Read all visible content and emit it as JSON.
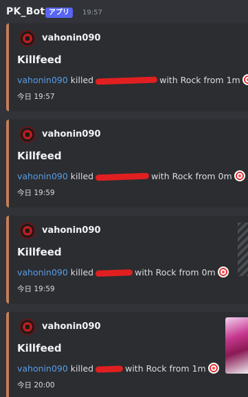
{
  "header": {
    "bot_name": "PK_Bot",
    "badge": "アプリ",
    "time": "19:57"
  },
  "embeds": [
    {
      "author": "vahonin090",
      "title": "Killfeed",
      "player": "vahonin090",
      "action": "killed",
      "weapon_text": "with Rock from 1m",
      "footer": "今日 19:57"
    },
    {
      "author": "vahonin090",
      "title": "Killfeed",
      "player": "vahonin090",
      "action": "killed",
      "weapon_text": "with Rock from 0m",
      "footer": "今日 19:59"
    },
    {
      "author": "vahonin090",
      "title": "Killfeed",
      "player": "vahonin090",
      "action": "killed",
      "weapon_text": "with Rock from 0m",
      "footer": "今日 19:59"
    },
    {
      "author": "vahonin090",
      "title": "Killfeed",
      "player": "vahonin090",
      "action": "killed",
      "weapon_text": "with Rock from 1m",
      "footer": "今日 20:00"
    }
  ],
  "colors": {
    "background": "#313338",
    "embed_bg": "#2b2d31",
    "embed_border": "#c67f58",
    "player_link": "#5a9ce6",
    "app_badge": "#5865f2",
    "redaction": "#e02020"
  },
  "icons": {
    "avatar": "avatar-icon",
    "target": "direct-hit-target-icon"
  }
}
